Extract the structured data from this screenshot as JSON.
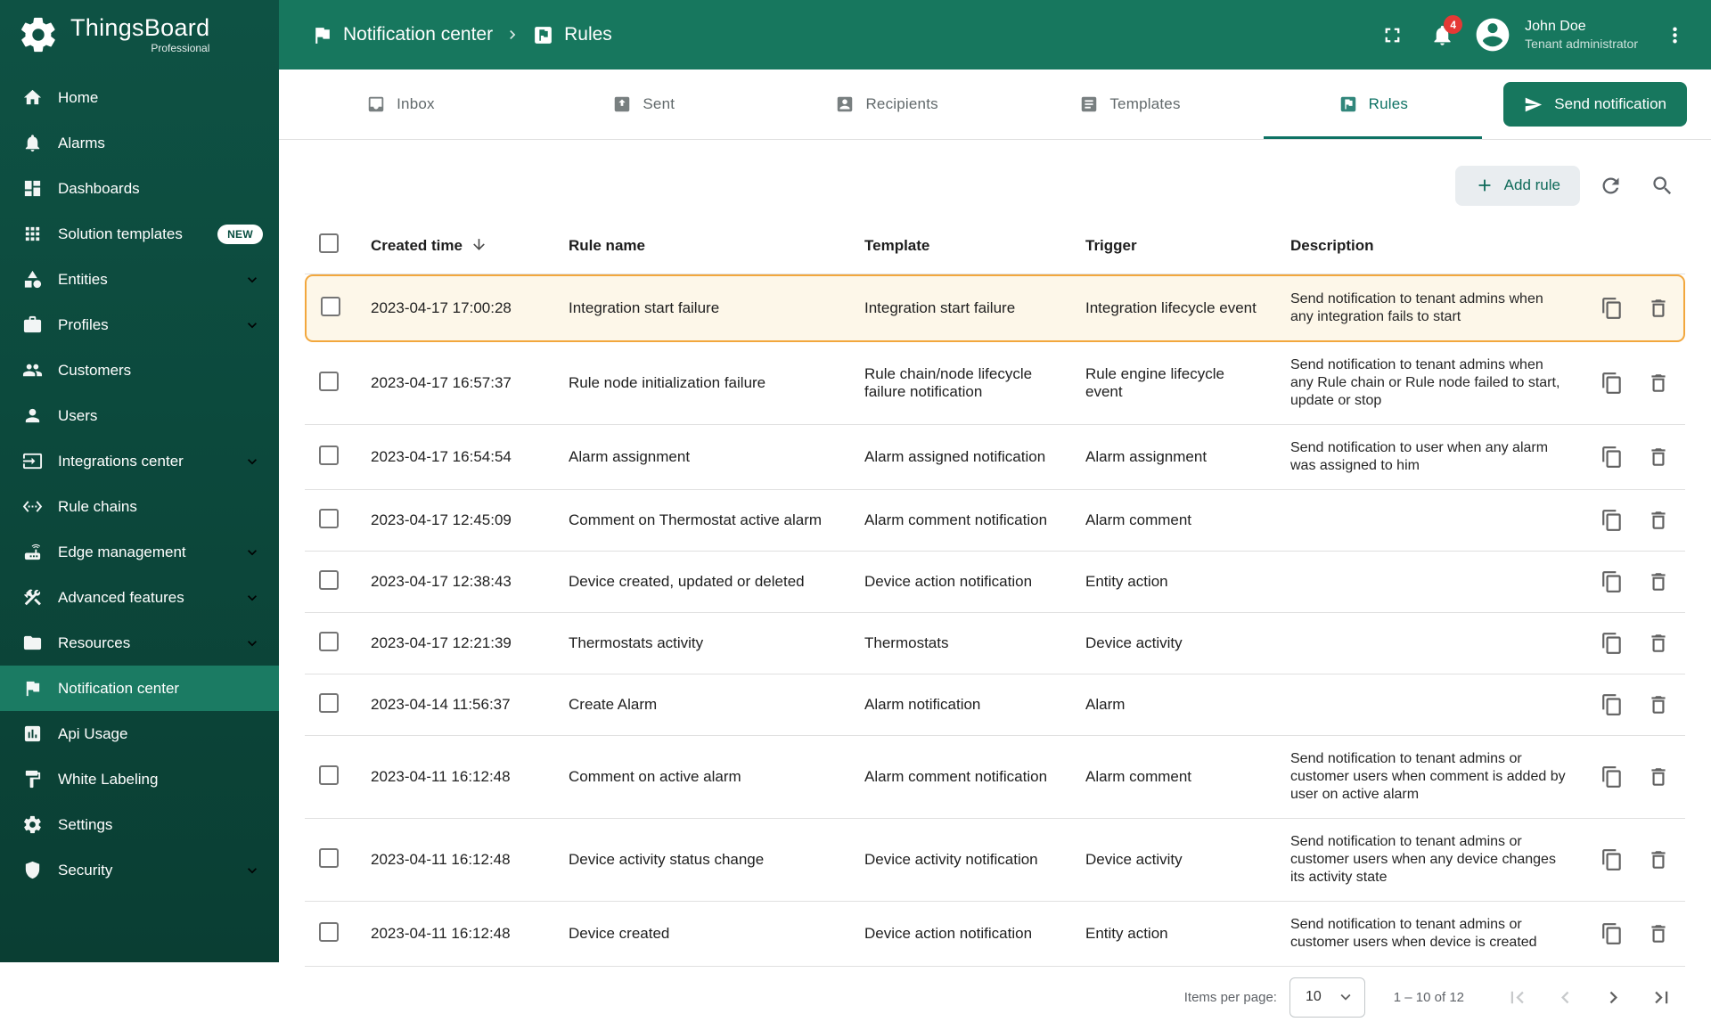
{
  "logo": {
    "title": "ThingsBoard",
    "subtitle": "Professional"
  },
  "breadcrumb": {
    "section": "Notification center",
    "page": "Rules"
  },
  "header": {
    "notification_count": "4",
    "user_name": "John Doe",
    "user_role": "Tenant administrator"
  },
  "sidebar": {
    "items": [
      {
        "label": "Home",
        "icon": "home"
      },
      {
        "label": "Alarms",
        "icon": "bell"
      },
      {
        "label": "Dashboards",
        "icon": "dashboard"
      },
      {
        "label": "Solution templates",
        "icon": "apps",
        "badge": "NEW"
      },
      {
        "label": "Entities",
        "icon": "category",
        "expandable": true
      },
      {
        "label": "Profiles",
        "icon": "briefcase",
        "expandable": true
      },
      {
        "label": "Customers",
        "icon": "people"
      },
      {
        "label": "Users",
        "icon": "person"
      },
      {
        "label": "Integrations center",
        "icon": "input",
        "expandable": true
      },
      {
        "label": "Rule chains",
        "icon": "ethernet"
      },
      {
        "label": "Edge management",
        "icon": "router",
        "expandable": true
      },
      {
        "label": "Advanced features",
        "icon": "construction",
        "expandable": true
      },
      {
        "label": "Resources",
        "icon": "folder",
        "expandable": true
      },
      {
        "label": "Notification center",
        "icon": "flag",
        "active": true
      },
      {
        "label": "Api Usage",
        "icon": "chart"
      },
      {
        "label": "White Labeling",
        "icon": "paint"
      },
      {
        "label": "Settings",
        "icon": "gear"
      },
      {
        "label": "Security",
        "icon": "shield",
        "expandable": true
      }
    ]
  },
  "tabs": {
    "items": [
      {
        "label": "Inbox",
        "icon": "inbox"
      },
      {
        "label": "Sent",
        "icon": "outbox"
      },
      {
        "label": "Recipients",
        "icon": "contact"
      },
      {
        "label": "Templates",
        "icon": "templates"
      },
      {
        "label": "Rules",
        "icon": "rules",
        "active": true
      }
    ],
    "send_button_label": "Send notification"
  },
  "toolbar": {
    "add_rule_label": "Add rule"
  },
  "table": {
    "columns": {
      "created_time": "Created time",
      "rule_name": "Rule name",
      "template": "Template",
      "trigger": "Trigger",
      "description": "Description"
    },
    "rows": [
      {
        "created_time": "2023-04-17 17:00:28",
        "rule_name": "Integration start failure",
        "template": "Integration start failure",
        "trigger": "Integration lifecycle event",
        "description": "Send notification to tenant admins when any integration fails to start",
        "highlighted": true
      },
      {
        "created_time": "2023-04-17 16:57:37",
        "rule_name": "Rule node initialization failure",
        "template": "Rule chain/node lifecycle failure notification",
        "trigger": "Rule engine lifecycle event",
        "description": "Send notification to tenant admins when any Rule chain or Rule node failed to start, update or stop"
      },
      {
        "created_time": "2023-04-17 16:54:54",
        "rule_name": "Alarm assignment",
        "template": "Alarm assigned notification",
        "trigger": "Alarm assignment",
        "description": "Send notification to user when any alarm was assigned to him"
      },
      {
        "created_time": "2023-04-17 12:45:09",
        "rule_name": "Comment on Thermostat active alarm",
        "template": "Alarm comment notification",
        "trigger": "Alarm comment",
        "description": ""
      },
      {
        "created_time": "2023-04-17 12:38:43",
        "rule_name": "Device created, updated or deleted",
        "template": "Device action notification",
        "trigger": "Entity action",
        "description": ""
      },
      {
        "created_time": "2023-04-17 12:21:39",
        "rule_name": "Thermostats activity",
        "template": "Thermostats",
        "trigger": "Device activity",
        "description": ""
      },
      {
        "created_time": "2023-04-14 11:56:37",
        "rule_name": "Create Alarm",
        "template": "Alarm notification",
        "trigger": "Alarm",
        "description": ""
      },
      {
        "created_time": "2023-04-11 16:12:48",
        "rule_name": "Comment on active alarm",
        "template": "Alarm comment notification",
        "trigger": "Alarm comment",
        "description": "Send notification to tenant admins or customer users when comment is added by user on active alarm"
      },
      {
        "created_time": "2023-04-11 16:12:48",
        "rule_name": "Device activity status change",
        "template": "Device activity notification",
        "trigger": "Device activity",
        "description": "Send notification to tenant admins or customer users when any device changes its activity state"
      },
      {
        "created_time": "2023-04-11 16:12:48",
        "rule_name": "Device created",
        "template": "Device action notification",
        "trigger": "Entity action",
        "description": "Send notification to tenant admins or customer users when device is created"
      }
    ]
  },
  "pagination": {
    "items_per_page_label": "Items per page:",
    "items_per_page_value": "10",
    "range": "1 – 10 of 12"
  },
  "icons": {
    "logo": "tb-gear",
    "breadcrumb_section": "flag",
    "breadcrumb_separator": "chevron-right",
    "breadcrumb_page": "rules",
    "fullscreen": "fullscreen",
    "notifications": "bell",
    "avatar": "account",
    "menu": "kebab",
    "send": "send",
    "add": "plus",
    "refresh": "refresh",
    "search": "search",
    "sort": "arrow-down",
    "select_caret": "chevron-down",
    "copy": "copy",
    "delete": "delete",
    "page_first": "page-first",
    "page_prev": "page-prev",
    "page_next": "page-next",
    "page_last": "page-last"
  },
  "colors": {
    "header_bg": "#17775e",
    "sidebar_top": "#0e5244",
    "sidebar_bottom": "#0a3e33",
    "sidebar_active_bg": "#1b7b63",
    "tab_active": "#0e7264",
    "send_button_bg": "#17775e",
    "add_rule_bg": "#e9edf0",
    "add_rule_text": "#0e6a59",
    "highlight_row_bg": "#fdf7e9",
    "highlight_row_border": "#f2a73d",
    "badge_red": "#e53935",
    "new_badge_text": "#0a4f41",
    "divider": "#e0e0e0"
  }
}
